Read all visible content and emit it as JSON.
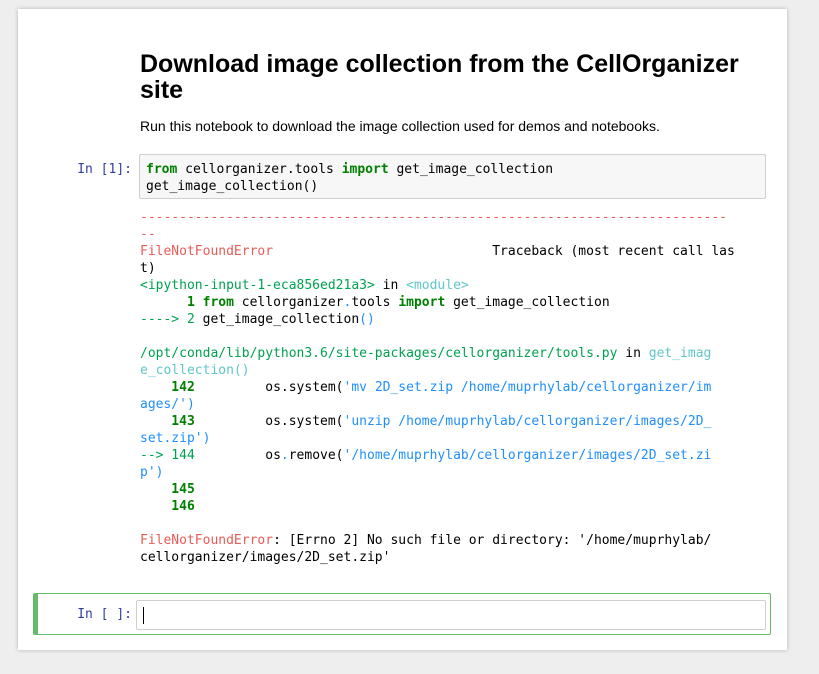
{
  "markdown": {
    "title": "Download image collection from the CellOrganizer site",
    "description": "Run this notebook to download the image collection used for demos and notebooks."
  },
  "cell1": {
    "prompt": "In [1]:",
    "code_line1_kw1": "from",
    "code_line1_mid": " cellorganizer.tools ",
    "code_line1_kw2": "import",
    "code_line1_end": " get_image_collection",
    "code_line2": "get_image_collection()"
  },
  "output": {
    "dash_line": "---------------------------------------------------------------------------",
    "dash_wrap": "--",
    "error_name": "FileNotFoundError",
    "traceback_label": "                            Traceback (most recent call las",
    "traceback_wrap": "t)",
    "input_ref": "<ipython-input-1-eca856ed21a3>",
    "in_word": " in ",
    "module_ref": "<module>",
    "line1_num": "      1 ",
    "line1_kw1": "from",
    "line1_mid": " cellorganizer",
    "line1_dot": ".",
    "line1_tools": "tools ",
    "line1_kw2": "import",
    "line1_end": " get_image_collection",
    "arrow2": "----> 2 ",
    "line2_text": "get_image_collection",
    "line2_paren": "()",
    "file_path": "/opt/conda/lib/python3.6/site-packages/cellorganizer/tools.py",
    "in_word2": " in ",
    "func_ref": "get_imag",
    "func_ref_wrap": "e_collection()",
    "l142_num": "    142",
    "l142_code": "         os.system(",
    "l142_str": "'mv 2D_set.zip /home/muprhylab/cellorganizer/im",
    "l142_str_wrap": "ages/'",
    "l142_close": ")",
    "l143_num": "    143",
    "l143_code": "         os.system(",
    "l143_str": "'unzip /home/muprhylab/cellorganizer/images/2D_",
    "l143_str_wrap": "set.zip'",
    "l143_close": ")",
    "l144_arrow": "--> 144",
    "l144_code": "         os",
    "l144_dot": ".",
    "l144_rest": "remove(",
    "l144_str": "'/home/muprhylab/cellorganizer/images/2D_set.zi",
    "l144_str_wrap": "p'",
    "l144_close": ")",
    "l145_num": "    145",
    "l146_num": "    146",
    "final_error_name": "FileNotFoundError",
    "final_msg": ": [Errno 2] No such file or directory: '/home/muprhylab/",
    "final_msg_wrap": "cellorganizer/images/2D_set.zip'"
  },
  "cell2": {
    "prompt": "In [ ]:",
    "value": ""
  }
}
